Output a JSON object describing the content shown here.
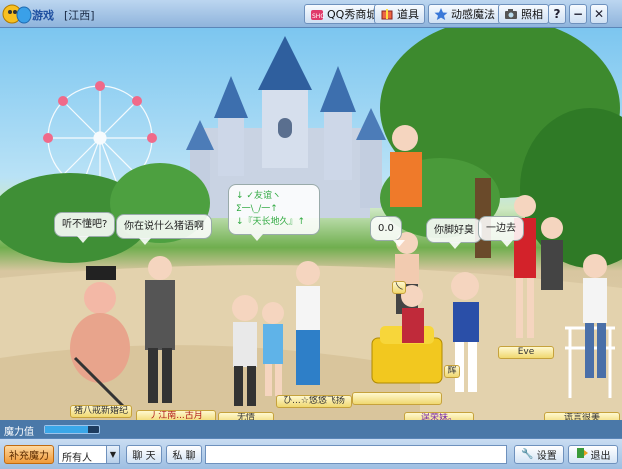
{
  "app": {
    "logo_text": "QQ游戏",
    "room_name": "[江西]"
  },
  "toolbar": {
    "shop_label": "QQ秀商城",
    "props_label": "道具",
    "magic_label": "动感魔法",
    "photo_label": "照相",
    "help_label": "?",
    "minimize_label": "−",
    "close_label": "✕"
  },
  "bubbles": [
    {
      "text": "听不懂吧?"
    },
    {
      "text": "你在说什么猪语啊"
    },
    {
      "text": "↓ ✓友谊ヽ\nΣ一\\_/一↑\n↓『天长地久』↑"
    },
    {
      "text": "0.0"
    },
    {
      "text": "你脚好臭"
    },
    {
      "text": "一边去"
    }
  ],
  "names": {
    "pig": "猪八戒新婚纪",
    "jiangnan": "丿江南...古月",
    "wuqing": "无情",
    "youyou": "ひ...☆悠悠飞扬",
    "mid": "",
    "piaopiao": "逞荣妹。",
    "eve": "Eve",
    "huang": "谎言很美",
    "hui": "辉",
    "xiao": "乀"
  },
  "magic": {
    "label": "魔力值",
    "level": 0.8,
    "fill_color": "#3aa7e8"
  },
  "bottom": {
    "replenish_label": "补充魔力",
    "target_value": "所有人",
    "chat_label": "聊 天",
    "private_label": "私 聊",
    "chat_input_value": "",
    "settings_label": "设置",
    "exit_label": "退出"
  }
}
